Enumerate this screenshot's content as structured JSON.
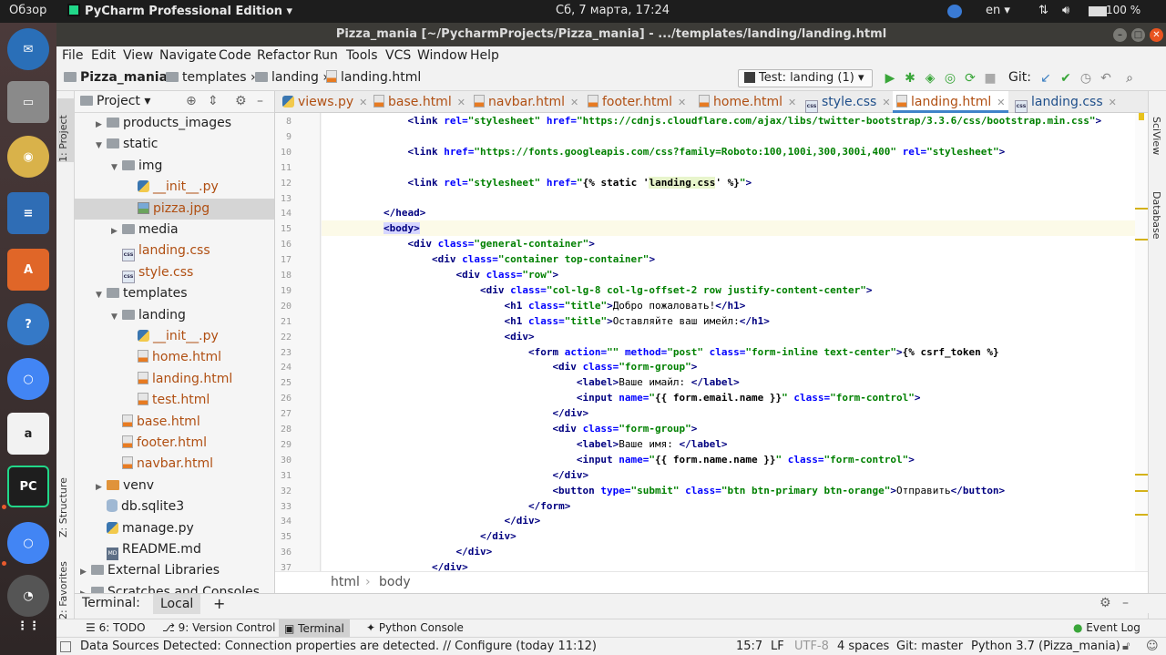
{
  "os_bar": {
    "overview": "Обзор",
    "app_name": "PyCharm Professional Edition",
    "clock": "Сб, 7 марта, 17:24",
    "lang": "en",
    "battery": "100 %"
  },
  "window": {
    "title": "Pizza_mania [~/PycharmProjects/Pizza_mania] - .../templates/landing/landing.html"
  },
  "menu": [
    "File",
    "Edit",
    "View",
    "Navigate",
    "Code",
    "Refactor",
    "Run",
    "Tools",
    "VCS",
    "Window",
    "Help"
  ],
  "nav": {
    "crumbs": [
      "Pizza_mania",
      "templates",
      "landing",
      "landing.html"
    ],
    "run_config": "Test: landing (1)",
    "git_label": "Git:"
  },
  "left_stripe": {
    "project": "1: Project",
    "structure": "Z: Structure",
    "favorites": "2: Favorites"
  },
  "right_stripe": {
    "sciview": "SciView",
    "database": "Database"
  },
  "project_panel": {
    "title": "Project",
    "tree": [
      {
        "label": "products_images",
        "kind": "folder",
        "indent": 1,
        "arrow": "▶"
      },
      {
        "label": "static",
        "kind": "folder",
        "indent": 1,
        "arrow": "▼"
      },
      {
        "label": "img",
        "kind": "folder",
        "indent": 2,
        "arrow": "▼"
      },
      {
        "label": "__init__.py",
        "kind": "py",
        "indent": 3,
        "arrow": ""
      },
      {
        "label": "pizza.jpg",
        "kind": "img",
        "indent": 3,
        "arrow": "",
        "selected": true
      },
      {
        "label": "media",
        "kind": "folder",
        "indent": 2,
        "arrow": "▶"
      },
      {
        "label": "landing.css",
        "kind": "css",
        "indent": 2,
        "arrow": ""
      },
      {
        "label": "style.css",
        "kind": "css",
        "indent": 2,
        "arrow": ""
      },
      {
        "label": "templates",
        "kind": "folder",
        "indent": 1,
        "arrow": "▼"
      },
      {
        "label": "landing",
        "kind": "folder",
        "indent": 2,
        "arrow": "▼"
      },
      {
        "label": "__init__.py",
        "kind": "py",
        "indent": 3,
        "arrow": ""
      },
      {
        "label": "home.html",
        "kind": "html",
        "indent": 3,
        "arrow": ""
      },
      {
        "label": "landing.html",
        "kind": "html",
        "indent": 3,
        "arrow": ""
      },
      {
        "label": "test.html",
        "kind": "html",
        "indent": 3,
        "arrow": ""
      },
      {
        "label": "base.html",
        "kind": "html",
        "indent": 2,
        "arrow": ""
      },
      {
        "label": "footer.html",
        "kind": "html",
        "indent": 2,
        "arrow": ""
      },
      {
        "label": "navbar.html",
        "kind": "html",
        "indent": 2,
        "arrow": ""
      },
      {
        "label": "venv",
        "kind": "folder-orange",
        "indent": 1,
        "arrow": "▶"
      },
      {
        "label": "db.sqlite3",
        "kind": "db",
        "indent": 1,
        "arrow": ""
      },
      {
        "label": "manage.py",
        "kind": "py",
        "indent": 1,
        "arrow": ""
      },
      {
        "label": "README.md",
        "kind": "md",
        "indent": 1,
        "arrow": ""
      },
      {
        "label": "External Libraries",
        "kind": "lib",
        "indent": 0,
        "arrow": "▶"
      },
      {
        "label": "Scratches and Consoles",
        "kind": "scratch",
        "indent": 0,
        "arrow": "▶"
      }
    ]
  },
  "editor_tabs": [
    {
      "label": "views.py",
      "kind": "py"
    },
    {
      "label": "base.html",
      "kind": "html"
    },
    {
      "label": "navbar.html",
      "kind": "html"
    },
    {
      "label": "footer.html",
      "kind": "html"
    },
    {
      "label": "home.html",
      "kind": "html"
    },
    {
      "label": "style.css",
      "kind": "css"
    },
    {
      "label": "landing.html",
      "kind": "html",
      "active": true
    },
    {
      "label": "landing.css",
      "kind": "css"
    }
  ],
  "code_lines": [
    {
      "n": "8",
      "html": "    <span class='tg'>&lt;link</span> <span class='at'>rel=</span><span class='sv'>\"stylesheet\"</span> <span class='at'>href=</span><span class='sv'>\"https://cdnjs.cloudflare.com/ajax/libs/twitter-bootstrap/3.3.6/css/bootstrap.min.css\"</span><span class='tg'>&gt;</span>"
    },
    {
      "n": "9",
      "html": ""
    },
    {
      "n": "10",
      "html": "    <span class='tg'>&lt;link</span> <span class='at'>href=</span><span class='sv'>\"https://fonts.googleapis.com/css?family=Roboto:100,100i,300,300i,400\"</span> <span class='at'>rel=</span><span class='sv'>\"stylesheet\"</span><span class='tg'>&gt;</span>"
    },
    {
      "n": "11",
      "html": ""
    },
    {
      "n": "12",
      "html": "    <span class='tg'>&lt;link</span> <span class='at'>rel=</span><span class='sv'>\"stylesheet\"</span> <span class='at'>href=</span><span class='sv'>\"</span><span class='tmpl'>{% static '<span class='grn'>landing.css</span>' %}</span><span class='sv'>\"</span><span class='tg'>&gt;</span>"
    },
    {
      "n": "13",
      "html": ""
    },
    {
      "n": "14",
      "html": "<span class='tg'>&lt;/head&gt;</span>"
    },
    {
      "n": "15",
      "html": "<span class='tg hl'>&lt;body&gt;</span>",
      "current": true
    },
    {
      "n": "16",
      "html": "    <span class='tg'>&lt;div</span> <span class='at'>class=</span><span class='sv'>\"general-container\"</span><span class='tg'>&gt;</span>"
    },
    {
      "n": "17",
      "html": "        <span class='tg'>&lt;div</span> <span class='at'>class=</span><span class='sv'>\"container top-container\"</span><span class='tg'>&gt;</span>"
    },
    {
      "n": "18",
      "html": "            <span class='tg'>&lt;div</span> <span class='at'>class=</span><span class='sv'>\"row\"</span><span class='tg'>&gt;</span>"
    },
    {
      "n": "19",
      "html": "                <span class='tg'>&lt;div</span> <span class='at'>class=</span><span class='sv'>\"col-lg-8 col-lg-offset-2 row justify-content-center\"</span><span class='tg'>&gt;</span>"
    },
    {
      "n": "20",
      "html": "                    <span class='tg'>&lt;h1</span> <span class='at'>class=</span><span class='sv'>\"title\"</span><span class='tg'>&gt;</span><span class='tx'>Добро пожаловать!</span><span class='tg'>&lt;/h1&gt;</span>"
    },
    {
      "n": "21",
      "html": "                    <span class='tg'>&lt;h1</span> <span class='at'>class=</span><span class='sv'>\"title\"</span><span class='tg'>&gt;</span><span class='tx'>Оставляйте ваш имейл:</span><span class='tg'>&lt;/h1&gt;</span>"
    },
    {
      "n": "22",
      "html": "                    <span class='tg'>&lt;div&gt;</span>"
    },
    {
      "n": "23",
      "html": "                        <span class='tg'>&lt;form</span> <span class='at'>action=</span><span class='sv'>\"\"</span> <span class='at'>method=</span><span class='sv'>\"post\"</span> <span class='at'>class=</span><span class='sv'>\"form-inline text-center\"</span><span class='tg'>&gt;</span><span class='tmpl'>{% csrf_token %}</span>"
    },
    {
      "n": "24",
      "html": "                            <span class='tg'>&lt;div</span> <span class='at'>class=</span><span class='sv'>\"form-group\"</span><span class='tg'>&gt;</span>"
    },
    {
      "n": "25",
      "html": "                                <span class='tg'>&lt;label&gt;</span><span class='tx'>Ваше имайл: </span><span class='tg'>&lt;/label&gt;</span>"
    },
    {
      "n": "26",
      "html": "                                <span class='tg'>&lt;input</span> <span class='at'>name=</span><span class='sv'>\"</span><span class='tmpl'>{{ form.email.name }}</span><span class='sv'>\"</span> <span class='at'>class=</span><span class='sv'>\"form-control\"</span><span class='tg'>&gt;</span>"
    },
    {
      "n": "27",
      "html": "                            <span class='tg'>&lt;/div&gt;</span>"
    },
    {
      "n": "28",
      "html": "                            <span class='tg'>&lt;div</span> <span class='at'>class=</span><span class='sv'>\"form-group\"</span><span class='tg'>&gt;</span>"
    },
    {
      "n": "29",
      "html": "                                <span class='tg'>&lt;label&gt;</span><span class='tx'>Ваше имя: </span><span class='tg'>&lt;/label&gt;</span>"
    },
    {
      "n": "30",
      "html": "                                <span class='tg'>&lt;input</span> <span class='at'>name=</span><span class='sv'>\"</span><span class='tmpl'>{{ form.name.name }}</span><span class='sv'>\"</span> <span class='at'>class=</span><span class='sv'>\"form-control\"</span><span class='tg'>&gt;</span>"
    },
    {
      "n": "31",
      "html": "                            <span class='tg'>&lt;/div&gt;</span>"
    },
    {
      "n": "32",
      "html": "                            <span class='tg'>&lt;button</span> <span class='at'>type=</span><span class='sv'>\"submit\"</span> <span class='at'>class=</span><span class='sv'>\"btn btn-primary btn-orange\"</span><span class='tg'>&gt;</span><span class='tx'>Отправить</span><span class='tg'>&lt;/button&gt;</span>"
    },
    {
      "n": "33",
      "html": "                        <span class='tg'>&lt;/form&gt;</span>"
    },
    {
      "n": "34",
      "html": "                    <span class='tg'>&lt;/div&gt;</span>"
    },
    {
      "n": "35",
      "html": "                <span class='tg'>&lt;/div&gt;</span>"
    },
    {
      "n": "36",
      "html": "            <span class='tg'>&lt;/div&gt;</span>"
    },
    {
      "n": "37",
      "html": "        <span class='tg'>&lt;/div&gt;</span>"
    }
  ],
  "editor_breadcrumb": [
    "html",
    "body"
  ],
  "terminal": {
    "label": "Terminal:",
    "tab": "Local",
    "add": "+"
  },
  "bottom_tabs": [
    {
      "label": "6: TODO"
    },
    {
      "label": "9: Version Control"
    },
    {
      "label": "Terminal",
      "active": true
    },
    {
      "label": "Python Console"
    }
  ],
  "event_log": "Event Log",
  "status": {
    "message": "Data Sources Detected: Connection properties are detected. // Configure (today 11:12)",
    "position": "15:7",
    "line_sep": "LF",
    "encoding": "UTF-8",
    "indent": "4 spaces",
    "branch": "Git: master",
    "interpreter": "Python 3.7 (Pizza_mania)"
  }
}
